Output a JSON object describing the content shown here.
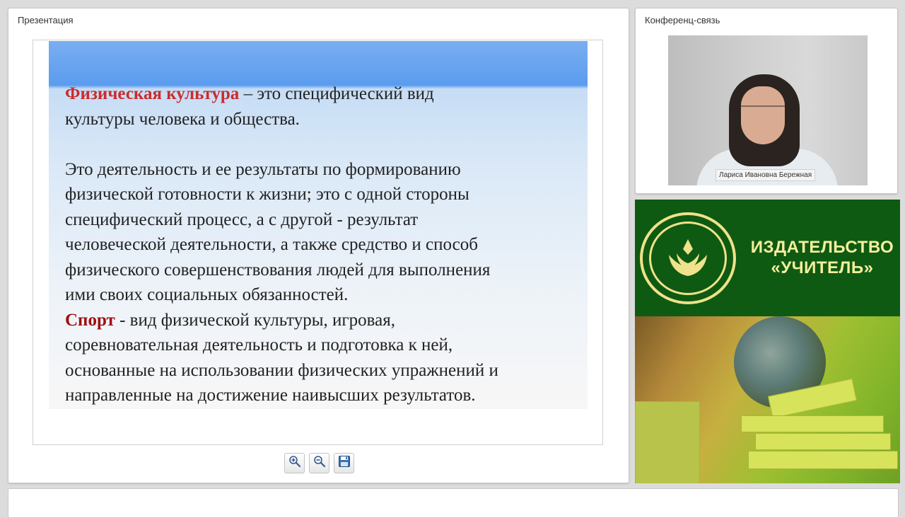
{
  "presentation": {
    "title": "Презентация",
    "slide": {
      "def1_term": "Физическая культура",
      "def1_rest": " – это  специфический вид",
      "def1_line2": "культуры человека и общества.",
      "para_lines": [
        " Это деятельность и ее результаты  по формированию",
        "физической готовности  к жизни;  это с одной стороны",
        "специфический процесс, а с другой - результат",
        "человеческой деятельности, а также средство и способ",
        "физического совершенствования людей для выполнения",
        "ими своих социальных обязанностей."
      ],
      "sport_term": "Спорт",
      "sport_rest": " -  вид физической культуры, игровая,",
      "sport_lines": [
        "соревновательная деятельность и подготовка к ней,",
        "основанные на использовании физических упражнений и",
        "направленные на достижение наивысших результатов."
      ]
    },
    "toolbar": {
      "zoom_in_icon": "zoom-in-icon",
      "zoom_out_icon": "zoom-out-icon",
      "save_icon": "floppy-disk-icon"
    }
  },
  "conference": {
    "title": "Конференц-связь",
    "participant_name": "Лариса Ивановна Бережная"
  },
  "banner": {
    "line1": "ИЗДАТЕЛЬСТВО",
    "line2": "«УЧИТЕЛЬ»"
  },
  "colors": {
    "term_red": "#cc2b2b",
    "sport_red": "#9e0f12",
    "banner_green": "#0f5a12",
    "banner_text": "#f4ef9c"
  }
}
